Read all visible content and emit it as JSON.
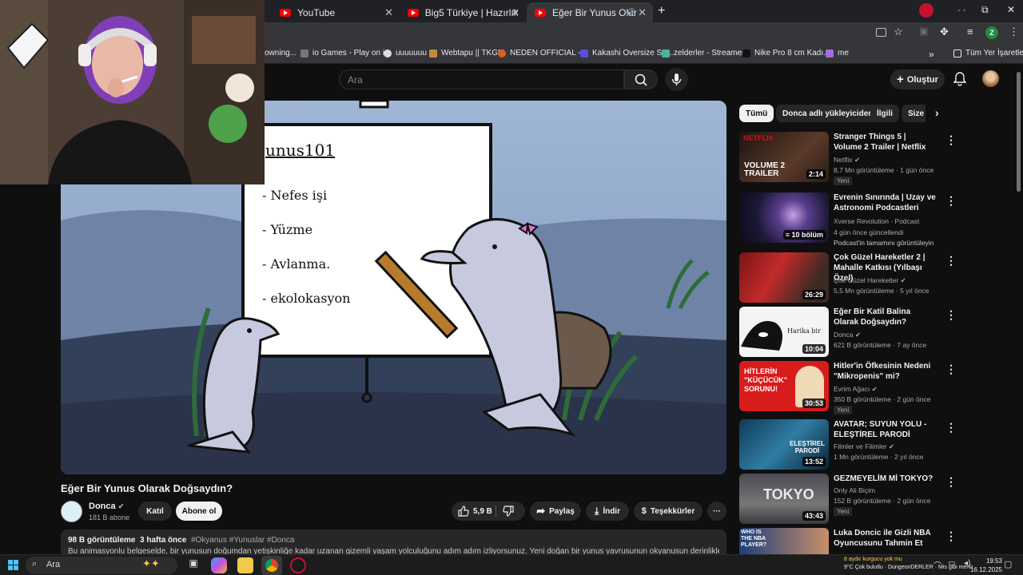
{
  "browser": {
    "tabs": [
      {
        "title": "YouTube",
        "active": false
      },
      {
        "title": "Big5 Türkiye | Hazırlık Sezonu ·",
        "active": false
      },
      {
        "title": "Eğer Bir Yunus Olarak Doğ",
        "active": true
      }
    ],
    "new_tab_icon": "plus-icon",
    "profile_letter": "Z"
  },
  "bookmarks": {
    "items": [
      "owning...",
      "io Games - Play on i...",
      "uuuuuuu",
      "Webtapu || TKGM",
      "NEDEN OFFICIAL -...",
      "Kakashi Oversize Sw...",
      "zelderler - Streamer...",
      "Nike Pro 8 cm Kadı...",
      "me"
    ],
    "all_bookmarks": "Tüm Yer İşaretleri"
  },
  "youtube": {
    "search_placeholder": "Ara",
    "create_label": "Oluştur"
  },
  "video": {
    "board_title": "unus101",
    "board_items": [
      "- Nefes işi",
      "- Yüzme",
      "- Avlanma.",
      "- ekolokasyon"
    ],
    "title": "Eğer Bir Yunus Olarak Doğsaydın?",
    "channel": "Donca",
    "subscribers": "181 B abone",
    "join_label": "Katıl",
    "subscribe_label": "Abone ol",
    "likes": "5,9 B",
    "share_label": "Paylaş",
    "download_label": "İndir",
    "thanks_label": "Teşekkürler",
    "views": "98 B görüntüleme",
    "age": "3 hafta önce",
    "tags": "#Okyanus #Yunuslar #Donca",
    "description": "Bu animasyonlu belgeselde, bir yunusun doğumdan yetişkinliğe kadar uzanan gizemli yaşam yolculuğunu adım adım izliyorsunuz. Yeni doğan bir yunus yavrusunun okyanusun derinliklerinde"
  },
  "chips": [
    "Tümü",
    "Donca adlı yükleyiciden",
    "İlgili",
    "Size"
  ],
  "recommendations": [
    {
      "title": "Stranger Things 5 | Volume 2 Trailer | Netflix",
      "channel": "Netflix",
      "stats": "8,7 Mn görüntüleme · 1 gün önce",
      "badge": "Yeni",
      "duration": "2:14",
      "thumb_text": "VOLUME 2 TRAILER",
      "brand": "NETFLIX"
    },
    {
      "title": "Evrenin Sınırında | Uzay ve Astronomi Podcastleri",
      "channel": "Xverse Revolution · Podcast",
      "stats": "4 gün önce güncellendi",
      "extra": "Podcast'in tamamını görüntüleyin",
      "duration": "10 bölüm"
    },
    {
      "title": "Çok Güzel Hareketler 2 | Mahalle Katkısı (Yılbaşı Özel)",
      "channel": "Çok Güzel Hareketler",
      "stats": "5,5 Mn görüntüleme · 5 yıl önce",
      "duration": "26:29"
    },
    {
      "title": "Eğer Bir Katil Balina Olarak Doğsaydın?",
      "channel": "Donca",
      "stats": "621 B görüntüleme · 7 ay önce",
      "duration": "10:04",
      "thumb_text": "Harika bir"
    },
    {
      "title": "Hitler'in Öfkesinin Nedeni \"Mikropenis\" mi?",
      "channel": "Evrim Ağacı",
      "stats": "350 B görüntüleme · 2 gün önce",
      "badge": "Yeni",
      "duration": "30:53",
      "thumb_text": "HİTLERİN \"KÜÇÜCÜK\" SORUNU!"
    },
    {
      "title": "AVATAR; SUYUN YOLU - ELEŞTİREL PARODİ",
      "channel": "Filmler ve Filimler",
      "stats": "1 Mn görüntüleme · 2 yıl önce",
      "duration": "13:52",
      "thumb_text": "ELEŞTİREL PARODİ"
    },
    {
      "title": "GEZMEYELİM Mİ TOKYO?",
      "channel": "Only Ali Biçim",
      "stats": "152 B görüntüleme · 2 gün önce",
      "badge": "Yeni",
      "duration": "43:43",
      "thumb_text": "TOKYO"
    },
    {
      "title": "Luka Doncic ile Gizli NBA Oyuncusunu Tahmin Et",
      "thumb_text": "WHO IS THE NBA PLAYER?"
    }
  ],
  "taskbar": {
    "search_placeholder": "Ara",
    "weather": "9°C  Çok bulutlu",
    "notification_line1": "8 aydır kurgucu yok mu",
    "notification_line2": "DungeonDERLER · Mis gibi menü",
    "time": "19:53",
    "date": "16.12.2025"
  },
  "colors": {
    "yt_background": "#0f0f0f",
    "yt_red": "#ff0000",
    "chip_bg": "#272727"
  }
}
